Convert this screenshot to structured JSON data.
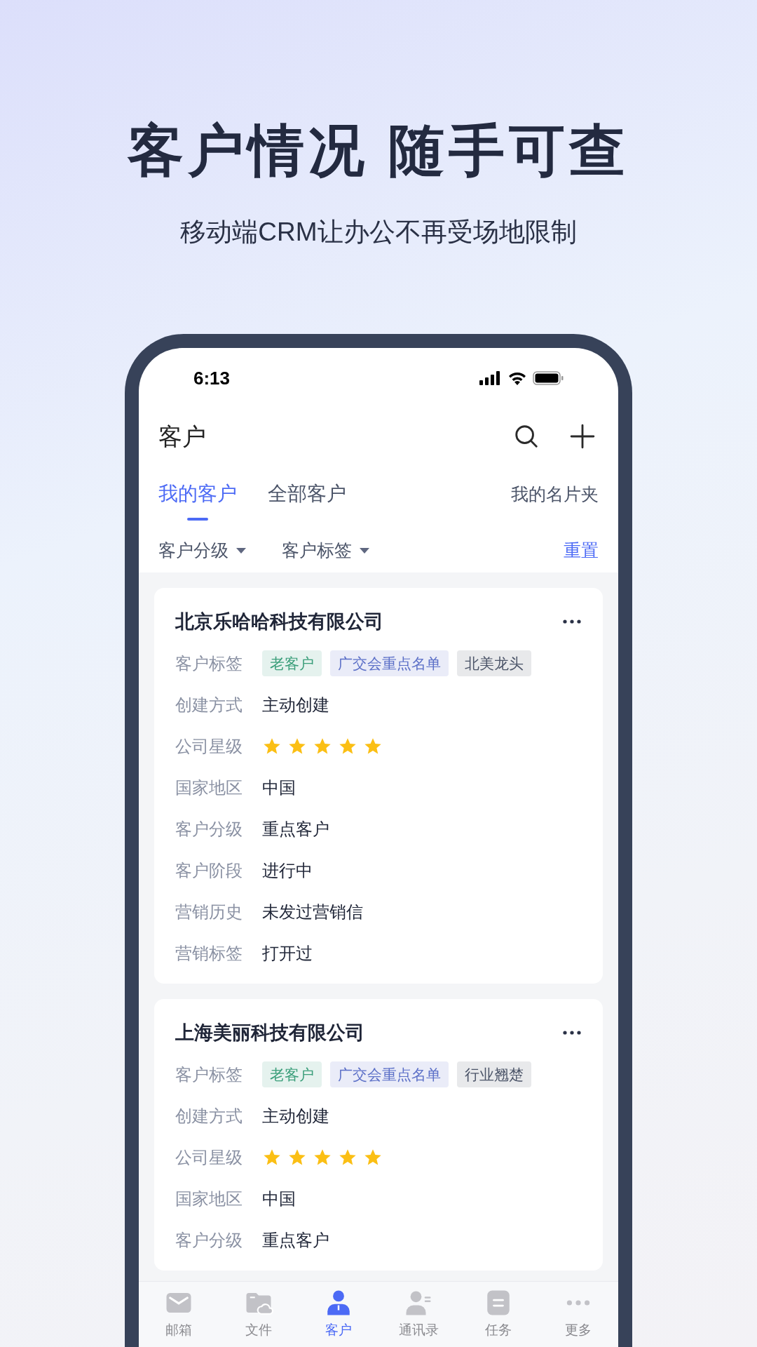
{
  "headline": "客户情况 随手可查",
  "subtitle": "移动端CRM让办公不再受场地限制",
  "status_bar": {
    "time": "6:13"
  },
  "header": {
    "title": "客户"
  },
  "tabs": [
    {
      "label": "我的客户",
      "selected": true
    },
    {
      "label": "全部客户",
      "selected": false
    }
  ],
  "card_holder_link": "我的名片夹",
  "filters": [
    "客户分级",
    "客户标签"
  ],
  "reset": "重置",
  "customers": [
    {
      "name": "北京乐哈哈科技有限公司",
      "rows": [
        {
          "kind": "tags",
          "label": "客户标签",
          "tags": [
            {
              "text": "老客户",
              "color": "#3a9e7a"
            },
            {
              "text": "广交会重点名单",
              "color": "#5b6fc7"
            },
            {
              "text": "北美龙头",
              "color": "#4b5468"
            }
          ]
        },
        {
          "kind": "text",
          "label": "创建方式",
          "value": "主动创建"
        },
        {
          "kind": "stars",
          "label": "公司星级",
          "stars": 5
        },
        {
          "kind": "text",
          "label": "国家地区",
          "value": "中国"
        },
        {
          "kind": "text",
          "label": "客户分级",
          "value": "重点客户"
        },
        {
          "kind": "text",
          "label": "客户阶段",
          "value": "进行中"
        },
        {
          "kind": "text",
          "label": "营销历史",
          "value": "未发过营销信"
        },
        {
          "kind": "text",
          "label": "营销标签",
          "value": "打开过"
        }
      ]
    },
    {
      "name": "上海美丽科技有限公司",
      "rows": [
        {
          "kind": "tags",
          "label": "客户标签",
          "tags": [
            {
              "text": "老客户",
              "color": "#3a9e7a"
            },
            {
              "text": "广交会重点名单",
              "color": "#5b6fc7"
            },
            {
              "text": "行业翘楚",
              "color": "#4b5468"
            }
          ]
        },
        {
          "kind": "text",
          "label": "创建方式",
          "value": "主动创建"
        },
        {
          "kind": "stars",
          "label": "公司星级",
          "stars": 5
        },
        {
          "kind": "text",
          "label": "国家地区",
          "value": "中国"
        },
        {
          "kind": "text",
          "label": "客户分级",
          "value": "重点客户"
        }
      ]
    }
  ],
  "bottom_nav": [
    {
      "label": "邮箱",
      "selected": false
    },
    {
      "label": "文件",
      "selected": false
    },
    {
      "label": "客户",
      "selected": true
    },
    {
      "label": "通讯录",
      "selected": false
    },
    {
      "label": "任务",
      "selected": false
    },
    {
      "label": "更多",
      "selected": false
    }
  ]
}
